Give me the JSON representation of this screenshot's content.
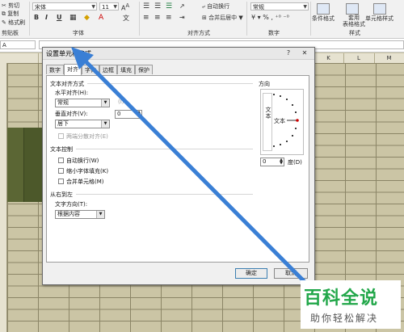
{
  "ribbon": {
    "clipboard": {
      "cut": "剪切",
      "copy": "复制",
      "format_painter": "格式刷",
      "group": "剪贴板"
    },
    "font": {
      "name": "宋体",
      "size": "11",
      "group": "字体"
    },
    "alignment": {
      "wrap": "自动换行",
      "merge": "合并后居中",
      "group": "对齐方式"
    },
    "number": {
      "format": "常规",
      "group": "数字"
    },
    "styles": {
      "conditional": "条件格式",
      "table": "套用\n表格格式",
      "cell": "单元格样式",
      "group": "样式"
    }
  },
  "name_box": {
    "value": "A"
  },
  "columns": [
    "",
    "",
    "",
    "",
    "",
    "",
    "",
    "",
    "",
    "K",
    "L",
    "M"
  ],
  "dialog": {
    "title": "设置单元格格式",
    "tabs": [
      "数字",
      "对齐",
      "字体",
      "边框",
      "填充",
      "保护"
    ],
    "active_tab": 1,
    "text_alignment": {
      "heading": "文本对齐方式",
      "horizontal_label": "水平对齐(H):",
      "horizontal_value": "常规",
      "indent_label": "(I):",
      "indent_value": "0",
      "vertical_label": "垂直对齐(V):",
      "vertical_value": "居下",
      "distributed_label": "两端分散对齐(E)"
    },
    "text_control": {
      "heading": "文本控制",
      "wrap_label": "自动换行(W)",
      "shrink_label": "缩小字体填充(K)",
      "merge_label": "合并单元格(M)"
    },
    "rtl": {
      "heading": "从右到左",
      "direction_label": "文字方向(T):",
      "direction_value": "根据内容"
    },
    "orientation": {
      "heading": "方向",
      "vertical_text": "文本",
      "horizontal_text": "文本",
      "degrees_value": "0",
      "degrees_label": "度(D)"
    },
    "ok": "确定",
    "cancel": "取消"
  },
  "watermark": {
    "big": "百科全说",
    "small": "助你轻松解决"
  },
  "colors": {
    "accent": "#3a7fd5",
    "watermark": "#22a74a"
  }
}
